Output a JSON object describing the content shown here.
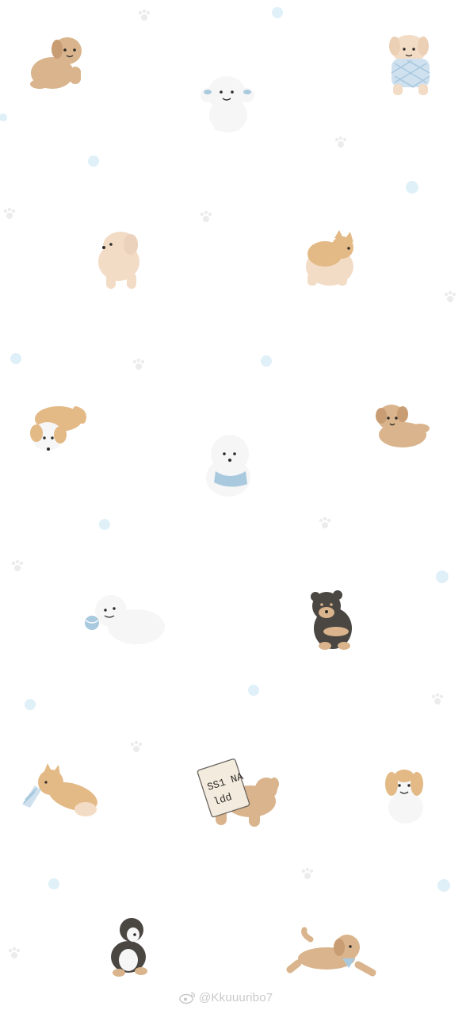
{
  "wallpaper": {
    "background": "#ffffff",
    "palette": {
      "tan": "#d9b48c",
      "tan_dark": "#c99d73",
      "cream": "#f3dcc6",
      "white_fur": "#f6f6f6",
      "outline_soft": "#e6e6e6",
      "black_fur": "#4a4642",
      "blue": "#a9c9df",
      "light_blue_dot": "#dff0f8",
      "paw_grey": "#ececec",
      "eye": "#2d2a28"
    },
    "dogs": [
      {
        "name": "dog-tan-poodle-sitting"
      },
      {
        "name": "dog-white-bichon-blue-bows"
      },
      {
        "name": "dog-cream-puppy-blue-sweater"
      },
      {
        "name": "dog-cream-puppy-side"
      },
      {
        "name": "dog-corgi-rear"
      },
      {
        "name": "dog-corgi-lying"
      },
      {
        "name": "dog-tan-poodle-lying"
      },
      {
        "name": "dog-white-bichon-blue-scarf"
      },
      {
        "name": "dog-white-dog-with-ball"
      },
      {
        "name": "dog-black-tan-puppy"
      },
      {
        "name": "dog-corgi-with-sock"
      },
      {
        "name": "dog-tan-dog-with-sign"
      },
      {
        "name": "dog-beagle-puppy"
      },
      {
        "name": "dog-tricolor-puppy"
      },
      {
        "name": "dog-tan-puppy-running"
      }
    ],
    "sign_scribble": "SS1 NA\nldd",
    "watermark": {
      "icon": "weibo-icon",
      "text": "@Kkuuuribo7"
    }
  }
}
